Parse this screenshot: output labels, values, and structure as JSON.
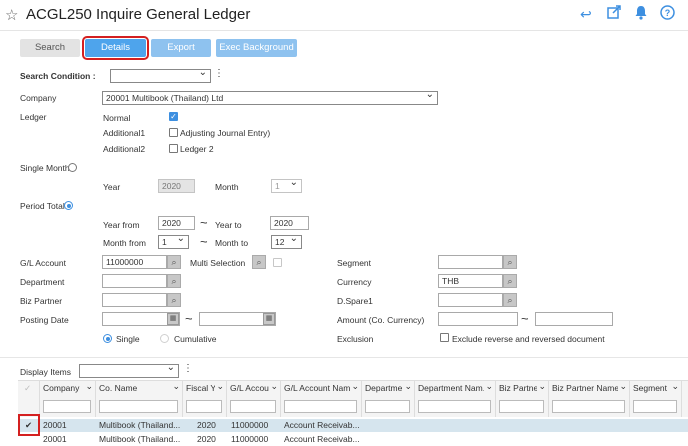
{
  "header": {
    "title": "ACGL250 Inquire General Ledger"
  },
  "toolbar": {
    "search": "Search",
    "details": "Details",
    "export": "Export",
    "exec_background": "Exec Background"
  },
  "form": {
    "search_condition_label": "Search Condition :",
    "company_label": "Company",
    "company_value": "20001 Multibook (Thailand) Ltd",
    "ledger_label": "Ledger",
    "normal_label": "Normal",
    "additional1_label": "Additional1",
    "additional1_option": "Adjusting Journal Entry)",
    "additional2_label": "Additional2",
    "additional2_option": "Ledger 2",
    "single_month_label": "Single Month",
    "year_label": "Year",
    "year_value": "2020",
    "month_label": "Month",
    "month_value": "1",
    "period_total_label": "Period Total",
    "year_from_label": "Year from",
    "year_from_value": "2020",
    "year_to_label": "Year to",
    "year_to_value": "2020",
    "month_from_label": "Month from",
    "month_from_value": "1",
    "month_to_label": "Month to",
    "month_to_value": "12",
    "gl_account_label": "G/L Account",
    "gl_account_value": "11000000",
    "multi_selection_label": "Multi Selection",
    "segment_label": "Segment",
    "department_label": "Department",
    "currency_label": "Currency",
    "currency_value": "THB",
    "biz_partner_label": "Biz Partner",
    "dspare1_label": "D.Spare1",
    "posting_date_label": "Posting Date",
    "amount_label": "Amount (Co. Currency)",
    "single_label": "Single",
    "cumulative_label": "Cumulative",
    "exclusion_label": "Exclusion",
    "exclusion_option": "Exclude reverse and reversed document",
    "tilde": "~"
  },
  "grid": {
    "display_items_label": "Display Items",
    "columns": [
      "Company",
      "Co. Name",
      "Fiscal Y...",
      "G/L Accou...",
      "G/L Account Nam...",
      "Departme...",
      "Department Nam...",
      "Biz Partne...",
      "Biz Partner Name...",
      "Segment"
    ],
    "rows": [
      [
        "20001",
        "Multibook (Thailand...",
        "2020",
        "11000000",
        "Account Receivab..."
      ],
      [
        "20001",
        "Multibook (Thailand...",
        "2020",
        "11000000",
        "Account Receivab..."
      ]
    ]
  },
  "colors": {
    "accent": "#3d8fe0",
    "button": "#8ec2ef",
    "button_active": "#4ea4ec",
    "highlight": "#d42020",
    "selected_row": "#d6e5ee"
  },
  "icons": [
    "star-icon",
    "back-icon",
    "popout-icon",
    "bell-icon",
    "help-icon",
    "search-icon",
    "calendar-icon",
    "check-icon",
    "kebab-icon",
    "sort-icon"
  ]
}
